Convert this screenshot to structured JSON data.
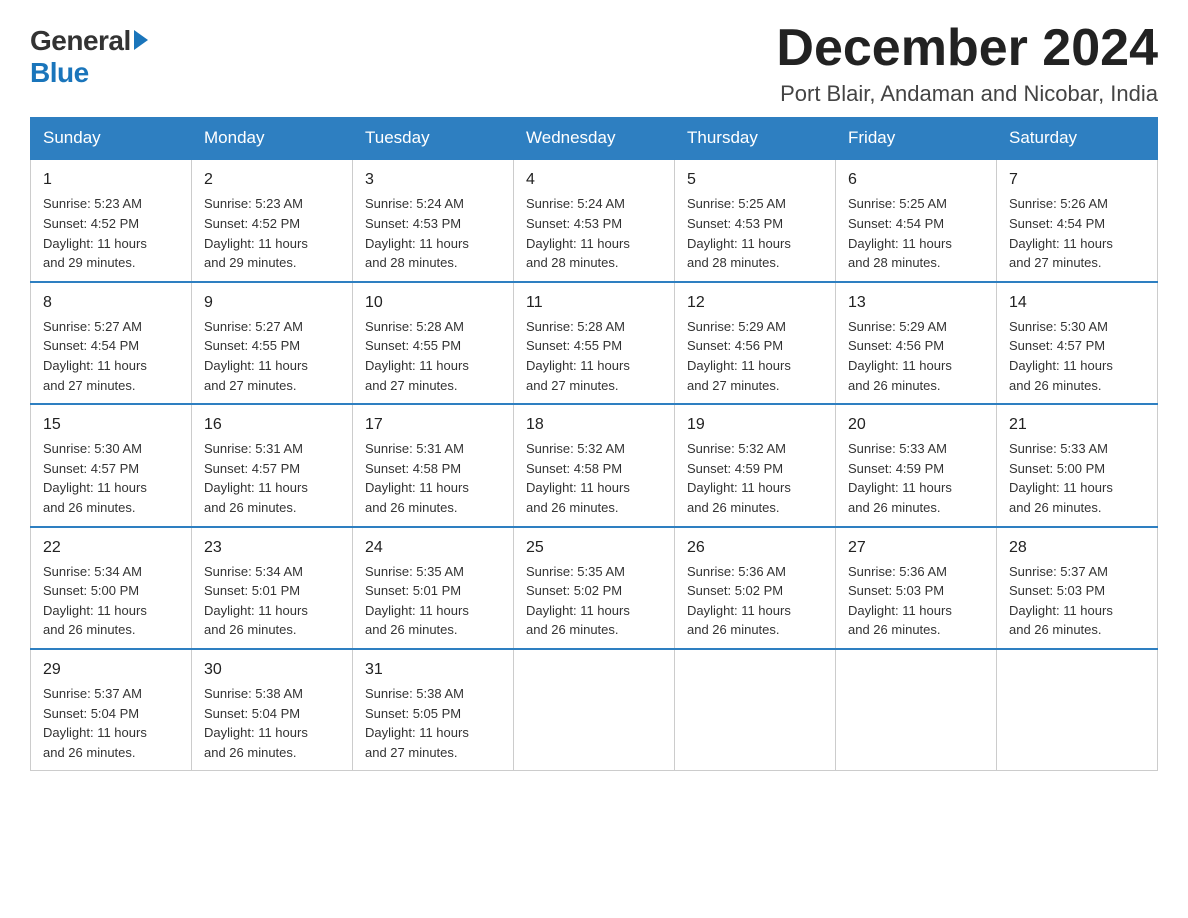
{
  "logo": {
    "general": "General",
    "blue": "Blue"
  },
  "header": {
    "title": "December 2024",
    "subtitle": "Port Blair, Andaman and Nicobar, India"
  },
  "days_of_week": [
    "Sunday",
    "Monday",
    "Tuesday",
    "Wednesday",
    "Thursday",
    "Friday",
    "Saturday"
  ],
  "weeks": [
    [
      {
        "day": "1",
        "sunrise": "5:23 AM",
        "sunset": "4:52 PM",
        "daylight": "11 hours and 29 minutes."
      },
      {
        "day": "2",
        "sunrise": "5:23 AM",
        "sunset": "4:52 PM",
        "daylight": "11 hours and 29 minutes."
      },
      {
        "day": "3",
        "sunrise": "5:24 AM",
        "sunset": "4:53 PM",
        "daylight": "11 hours and 28 minutes."
      },
      {
        "day": "4",
        "sunrise": "5:24 AM",
        "sunset": "4:53 PM",
        "daylight": "11 hours and 28 minutes."
      },
      {
        "day": "5",
        "sunrise": "5:25 AM",
        "sunset": "4:53 PM",
        "daylight": "11 hours and 28 minutes."
      },
      {
        "day": "6",
        "sunrise": "5:25 AM",
        "sunset": "4:54 PM",
        "daylight": "11 hours and 28 minutes."
      },
      {
        "day": "7",
        "sunrise": "5:26 AM",
        "sunset": "4:54 PM",
        "daylight": "11 hours and 27 minutes."
      }
    ],
    [
      {
        "day": "8",
        "sunrise": "5:27 AM",
        "sunset": "4:54 PM",
        "daylight": "11 hours and 27 minutes."
      },
      {
        "day": "9",
        "sunrise": "5:27 AM",
        "sunset": "4:55 PM",
        "daylight": "11 hours and 27 minutes."
      },
      {
        "day": "10",
        "sunrise": "5:28 AM",
        "sunset": "4:55 PM",
        "daylight": "11 hours and 27 minutes."
      },
      {
        "day": "11",
        "sunrise": "5:28 AM",
        "sunset": "4:55 PM",
        "daylight": "11 hours and 27 minutes."
      },
      {
        "day": "12",
        "sunrise": "5:29 AM",
        "sunset": "4:56 PM",
        "daylight": "11 hours and 27 minutes."
      },
      {
        "day": "13",
        "sunrise": "5:29 AM",
        "sunset": "4:56 PM",
        "daylight": "11 hours and 26 minutes."
      },
      {
        "day": "14",
        "sunrise": "5:30 AM",
        "sunset": "4:57 PM",
        "daylight": "11 hours and 26 minutes."
      }
    ],
    [
      {
        "day": "15",
        "sunrise": "5:30 AM",
        "sunset": "4:57 PM",
        "daylight": "11 hours and 26 minutes."
      },
      {
        "day": "16",
        "sunrise": "5:31 AM",
        "sunset": "4:57 PM",
        "daylight": "11 hours and 26 minutes."
      },
      {
        "day": "17",
        "sunrise": "5:31 AM",
        "sunset": "4:58 PM",
        "daylight": "11 hours and 26 minutes."
      },
      {
        "day": "18",
        "sunrise": "5:32 AM",
        "sunset": "4:58 PM",
        "daylight": "11 hours and 26 minutes."
      },
      {
        "day": "19",
        "sunrise": "5:32 AM",
        "sunset": "4:59 PM",
        "daylight": "11 hours and 26 minutes."
      },
      {
        "day": "20",
        "sunrise": "5:33 AM",
        "sunset": "4:59 PM",
        "daylight": "11 hours and 26 minutes."
      },
      {
        "day": "21",
        "sunrise": "5:33 AM",
        "sunset": "5:00 PM",
        "daylight": "11 hours and 26 minutes."
      }
    ],
    [
      {
        "day": "22",
        "sunrise": "5:34 AM",
        "sunset": "5:00 PM",
        "daylight": "11 hours and 26 minutes."
      },
      {
        "day": "23",
        "sunrise": "5:34 AM",
        "sunset": "5:01 PM",
        "daylight": "11 hours and 26 minutes."
      },
      {
        "day": "24",
        "sunrise": "5:35 AM",
        "sunset": "5:01 PM",
        "daylight": "11 hours and 26 minutes."
      },
      {
        "day": "25",
        "sunrise": "5:35 AM",
        "sunset": "5:02 PM",
        "daylight": "11 hours and 26 minutes."
      },
      {
        "day": "26",
        "sunrise": "5:36 AM",
        "sunset": "5:02 PM",
        "daylight": "11 hours and 26 minutes."
      },
      {
        "day": "27",
        "sunrise": "5:36 AM",
        "sunset": "5:03 PM",
        "daylight": "11 hours and 26 minutes."
      },
      {
        "day": "28",
        "sunrise": "5:37 AM",
        "sunset": "5:03 PM",
        "daylight": "11 hours and 26 minutes."
      }
    ],
    [
      {
        "day": "29",
        "sunrise": "5:37 AM",
        "sunset": "5:04 PM",
        "daylight": "11 hours and 26 minutes."
      },
      {
        "day": "30",
        "sunrise": "5:38 AM",
        "sunset": "5:04 PM",
        "daylight": "11 hours and 26 minutes."
      },
      {
        "day": "31",
        "sunrise": "5:38 AM",
        "sunset": "5:05 PM",
        "daylight": "11 hours and 27 minutes."
      },
      null,
      null,
      null,
      null
    ]
  ],
  "labels": {
    "sunrise": "Sunrise:",
    "sunset": "Sunset:",
    "daylight": "Daylight:"
  }
}
